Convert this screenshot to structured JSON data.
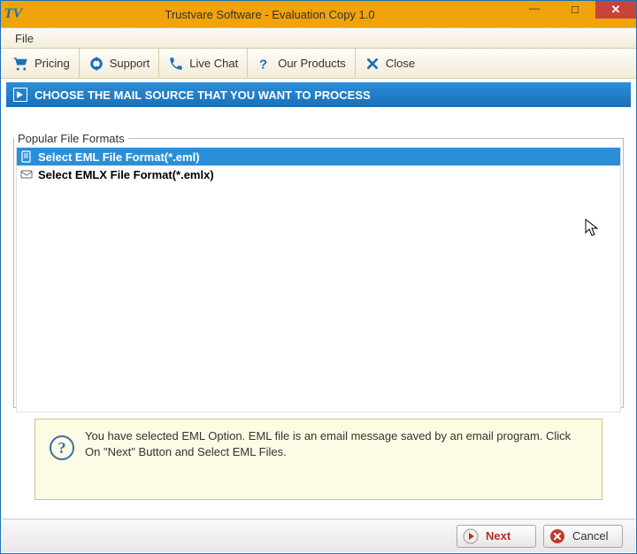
{
  "window": {
    "title": "Trustvare Software - Evaluation Copy 1.0",
    "logo_text": "TV"
  },
  "menu": {
    "file": "File"
  },
  "toolbar": {
    "pricing": "Pricing",
    "support": "Support",
    "livechat": "Live Chat",
    "products": "Our Products",
    "close": "Close"
  },
  "section_header": "CHOOSE THE MAIL SOURCE THAT YOU WANT TO PROCESS",
  "formats": {
    "legend": "Popular File Formats",
    "items": [
      {
        "label": "Select EML File Format(*.eml)",
        "selected": true
      },
      {
        "label": "Select EMLX File Format(*.emlx)",
        "selected": false
      }
    ]
  },
  "info": {
    "text": "You have selected EML Option. EML file is an email message saved by an email program. Click On \"Next\" Button and Select EML Files."
  },
  "footer": {
    "next": "Next",
    "cancel": "Cancel"
  }
}
